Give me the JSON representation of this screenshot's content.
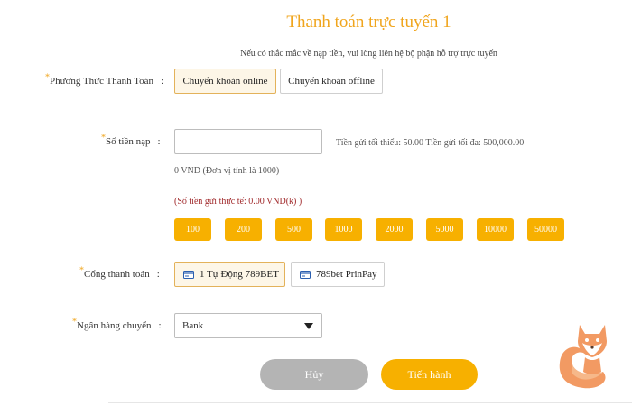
{
  "header": {
    "title": "Thanh toán trực tuyến 1",
    "subtitle": "Nếu có thắc mắc về nạp tiền, vui lòng liên hệ bộ phận hỗ trợ trực tuyến"
  },
  "payment_method": {
    "label": "Phương Thức Thanh Toán",
    "options": [
      "Chuyển khoản online",
      "Chuyển khoản offline"
    ],
    "selected": "Chuyển khoản online"
  },
  "amount": {
    "label": "Số tiền nạp",
    "value": "",
    "limits_text": "Tiền gửi tối thiểu: 50.00 Tiền gửi tối đa: 500,000.00",
    "unit_note": "0 VND (Đơn vị tính là 1000)",
    "actual_note": "(Số tiền gửi thực tế: 0.00 VND(k) )",
    "quick_amounts": [
      "100",
      "200",
      "500",
      "1000",
      "2000",
      "5000",
      "10000",
      "50000"
    ]
  },
  "gateway": {
    "label": "Cổng thanh toán",
    "options": [
      "1 Tự Động 789BET",
      "789bet PrinPay"
    ],
    "selected": "1 Tự Động 789BET"
  },
  "bank": {
    "label": "Ngân hàng chuyển",
    "selected": "Bank"
  },
  "actions": {
    "cancel_label": "Hủy",
    "submit_label": "Tiến hành"
  },
  "colors": {
    "accent": "#f7b000",
    "title": "#f0a51d",
    "cancel": "#b4b4b4",
    "warning_text": "#a0282a"
  }
}
